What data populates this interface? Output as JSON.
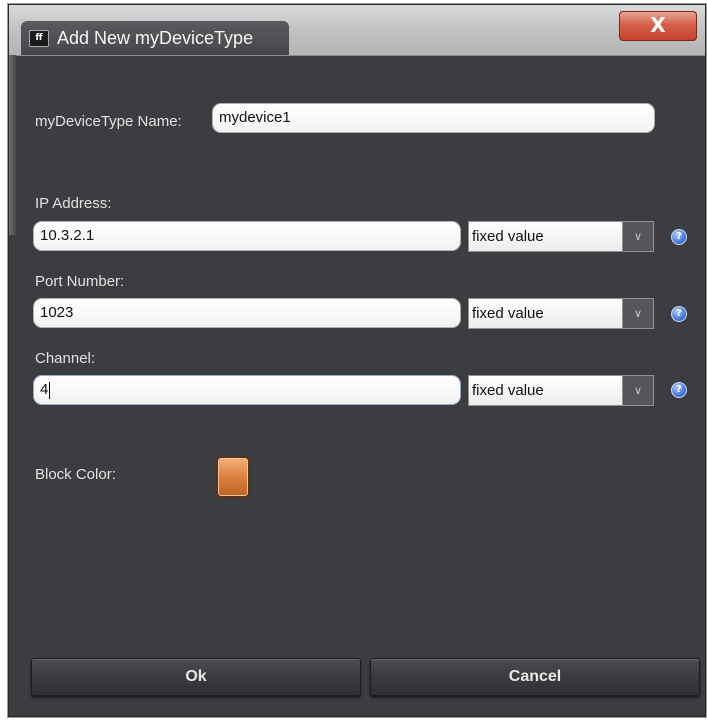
{
  "window": {
    "title": "Add New myDeviceType",
    "app_icon": "ff",
    "close_label": "X"
  },
  "form": {
    "name_label": "myDeviceType Name:",
    "name_value": "mydevice1",
    "ip": {
      "label": "IP Address:",
      "value": "10.3.2.1",
      "mode": "fixed value"
    },
    "port": {
      "label": "Port Number:",
      "value": "1023",
      "mode": "fixed value"
    },
    "channel": {
      "label": "Channel:",
      "value": "4",
      "mode": "fixed value"
    },
    "block_color_label": "Block Color:",
    "block_color": "#d9803f"
  },
  "icons": {
    "dropdown": "chevron-down-icon",
    "help": "help-icon",
    "help_glyph": "?",
    "chevron_glyph": "∨"
  },
  "buttons": {
    "ok": "Ok",
    "cancel": "Cancel"
  }
}
